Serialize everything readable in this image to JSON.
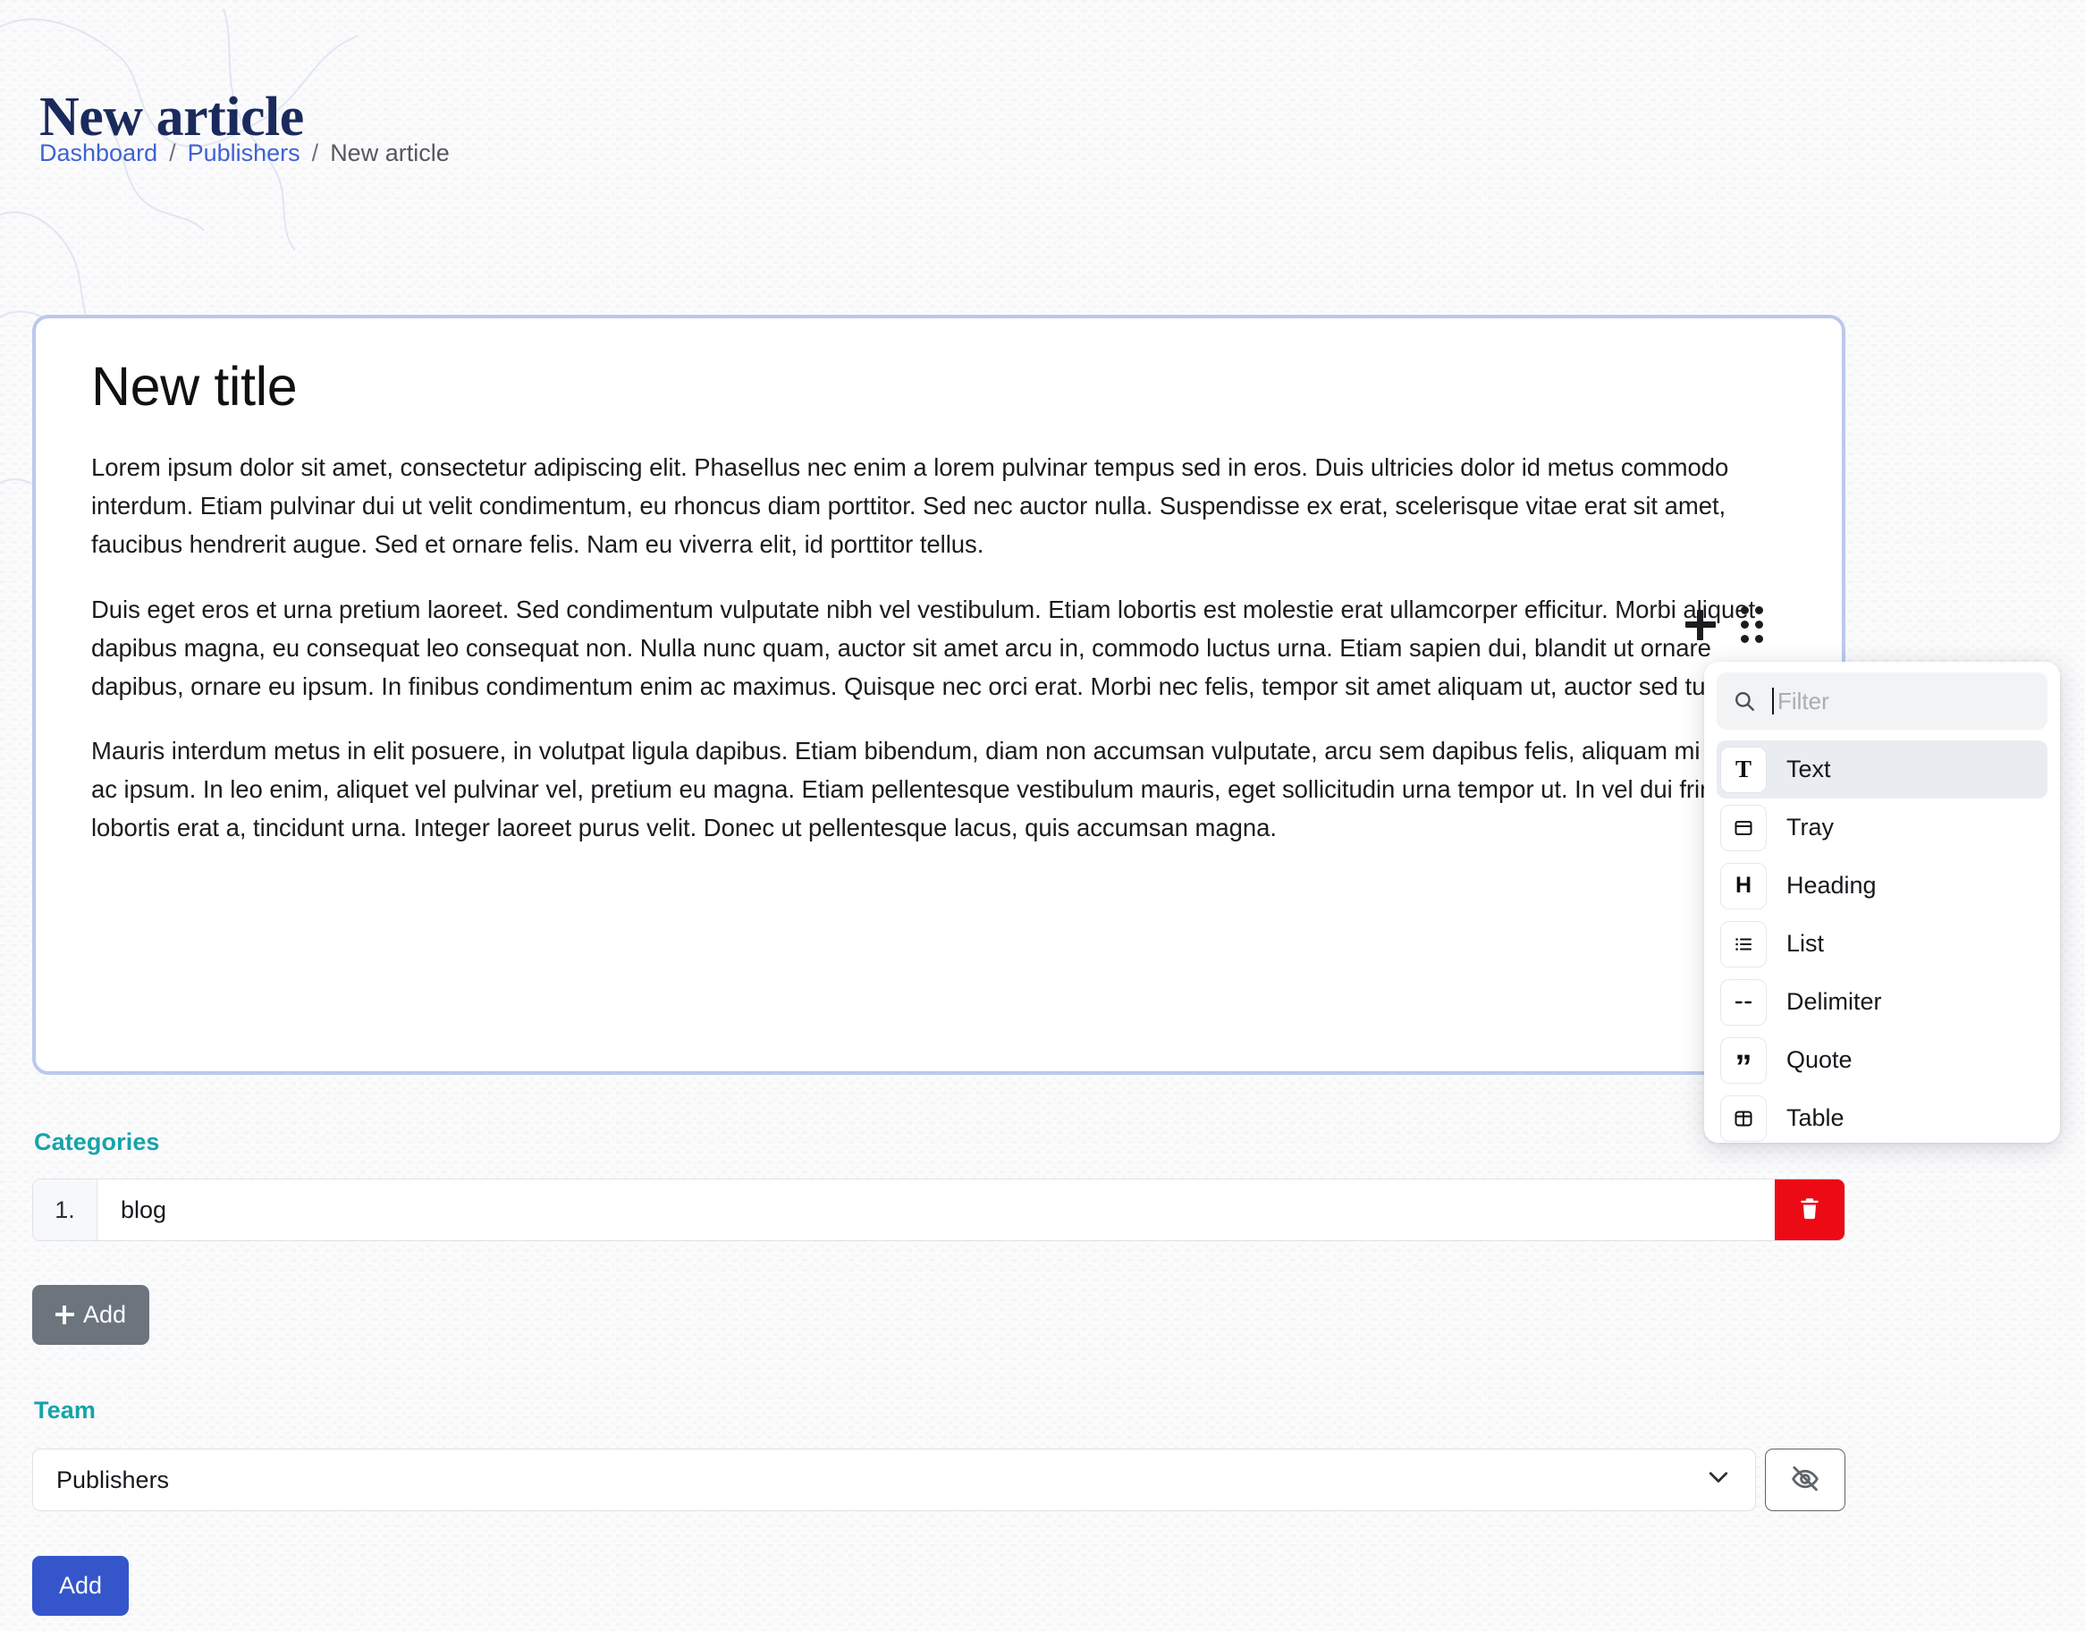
{
  "header": {
    "title": "New article",
    "breadcrumb": [
      {
        "label": "Dashboard",
        "link": true
      },
      {
        "label": "Publishers",
        "link": true
      },
      {
        "label": "New article",
        "link": false
      }
    ],
    "separator": "/"
  },
  "editor": {
    "title": "New title",
    "paragraphs": [
      "Lorem ipsum dolor sit amet, consectetur adipiscing elit. Phasellus nec enim a lorem pulvinar tempus sed in eros. Duis ultricies dolor id metus commodo interdum. Etiam pulvinar dui ut velit condimentum, eu rhoncus diam porttitor. Sed nec auctor nulla. Suspendisse ex erat, scelerisque vitae erat sit amet, faucibus hendrerit augue. Sed et ornare felis. Nam eu viverra elit, id porttitor tellus.",
      "Duis eget eros et urna pretium laoreet. Sed condimentum vulputate nibh vel vestibulum. Etiam lobortis est molestie erat ullamcorper efficitur. Morbi aliquet dapibus magna, eu consequat leo consequat non. Nulla nunc quam, auctor sit amet arcu in, commodo luctus urna. Etiam sapien dui, blandit ut ornare dapibus, ornare eu ipsum. In finibus condimentum enim ac maximus. Quisque nec orci erat. Morbi nec felis, tempor sit amet aliquam ut, auctor sed turpis.",
      "Mauris interdum metus in elit posuere, in volutpat ligula dapibus. Etiam bibendum, diam non accumsan vulputate, arcu sem dapibus felis, aliquam mi massa ac ipsum. In leo enim, aliquet vel pulvinar vel, pretium eu magna. Etiam pellentesque vestibulum mauris, eget sollicitudin urna tempor ut. In vel dui fringilla, lobortis erat a, tincidunt urna. Integer laoreet purus velit. Donec ut pellentesque lacus, quis accumsan magna."
    ]
  },
  "block_popup": {
    "search_placeholder": "Filter",
    "search_value": "",
    "items": [
      {
        "label": "Text",
        "icon": "text-icon",
        "active": true
      },
      {
        "label": "Tray",
        "icon": "tray-icon",
        "active": false
      },
      {
        "label": "Heading",
        "icon": "heading-icon",
        "active": false
      },
      {
        "label": "List",
        "icon": "list-icon",
        "active": false
      },
      {
        "label": "Delimiter",
        "icon": "delimiter-icon",
        "active": false
      },
      {
        "label": "Quote",
        "icon": "quote-icon",
        "active": false
      },
      {
        "label": "Table",
        "icon": "table-icon",
        "active": false
      }
    ]
  },
  "categories": {
    "label": "Categories",
    "rows": [
      {
        "index": "1.",
        "value": "blog"
      }
    ],
    "add_label": "Add"
  },
  "team": {
    "label": "Team",
    "selected": "Publishers",
    "options": [
      "Publishers"
    ]
  },
  "submit": {
    "label": "Add"
  },
  "colors": {
    "accent_teal": "#16a3a8",
    "link_blue": "#3f62d4",
    "primary_blue": "#3456ca",
    "danger_red": "#ec0b15",
    "gray_button": "#6c757d",
    "editor_border": "#bcc8ec",
    "title_navy": "#1b2a5c",
    "page_bg": "#fbfbfc"
  }
}
